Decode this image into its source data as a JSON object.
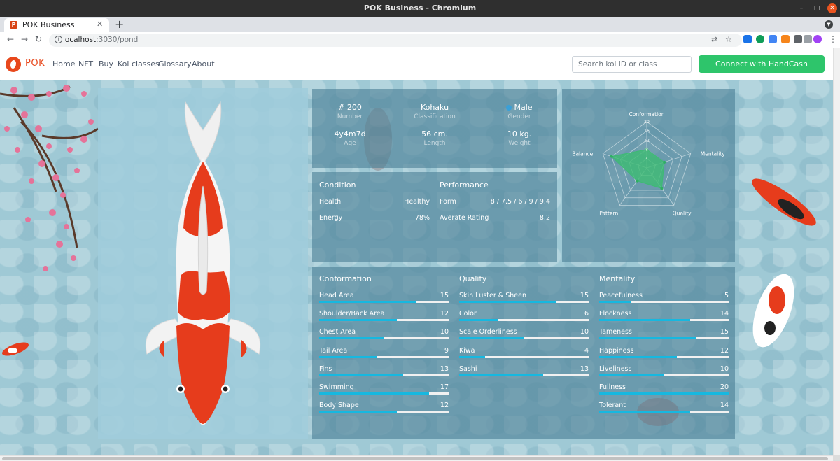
{
  "window": {
    "title": "POK Business - Chromium"
  },
  "browser": {
    "tab_title": "POK Business",
    "url_host": "localhost",
    "url_rest": ":3030/pond"
  },
  "nav": {
    "logo": "POK",
    "links": [
      "Home",
      "NFT",
      "Buy",
      "Koi classes",
      "Glossary",
      "About"
    ],
    "search_placeholder": "Search koi ID or class",
    "connect_label": "Connect with HandCash"
  },
  "koi": {
    "number": "# 200",
    "number_label": "Number",
    "classification": "Kohaku",
    "classification_label": "Classification",
    "gender": "Male",
    "gender_label": "Gender",
    "age": "4y4m7d",
    "age_label": "Age",
    "length": "56 cm.",
    "length_label": "Length",
    "weight": "10 kg.",
    "weight_label": "Weight"
  },
  "condition": {
    "title": "Condition",
    "health_label": "Health",
    "health_value": "Healthy",
    "energy_label": "Energy",
    "energy_value": "78%"
  },
  "performance": {
    "title": "Performance",
    "form_label": "Form",
    "form_value": "8 / 7.5 / 6 / 9 / 9.4",
    "rating_label": "Averate Rating",
    "rating_value": "8.2"
  },
  "radar": {
    "axes": [
      "Conformation",
      "Mentality",
      "Quality",
      "Pattern",
      "Balance"
    ],
    "ticks": [
      "4",
      "8",
      "12",
      "16",
      "20"
    ],
    "max": 20,
    "values": [
      8,
      8,
      11,
      7,
      16
    ],
    "fill_color": "#3dbb73"
  },
  "traits": {
    "max": 20,
    "bar_color": "#16b8e0",
    "conformation": {
      "title": "Conformation",
      "items": [
        {
          "name": "Head Area",
          "value": 15
        },
        {
          "name": "Shoulder/Back Area",
          "value": 12
        },
        {
          "name": "Chest Area",
          "value": 10
        },
        {
          "name": "Tail Area",
          "value": 9
        },
        {
          "name": "Fins",
          "value": 13
        },
        {
          "name": "Swimming",
          "value": 17
        },
        {
          "name": "Body Shape",
          "value": 12
        }
      ]
    },
    "quality": {
      "title": "Quality",
      "items": [
        {
          "name": "Skin Luster & Sheen",
          "value": 15
        },
        {
          "name": "Color",
          "value": 6
        },
        {
          "name": "Scale Orderliness",
          "value": 10
        },
        {
          "name": "Kiwa",
          "value": 4
        },
        {
          "name": "Sashi",
          "value": 13
        }
      ]
    },
    "mentality": {
      "title": "Mentality",
      "items": [
        {
          "name": "Peacefulness",
          "value": 5
        },
        {
          "name": "Flockness",
          "value": 14
        },
        {
          "name": "Tameness",
          "value": 15
        },
        {
          "name": "Happiness",
          "value": 12
        },
        {
          "name": "Liveliness",
          "value": 10
        },
        {
          "name": "Fullness",
          "value": 20
        },
        {
          "name": "Tolerant",
          "value": 14
        }
      ]
    }
  }
}
